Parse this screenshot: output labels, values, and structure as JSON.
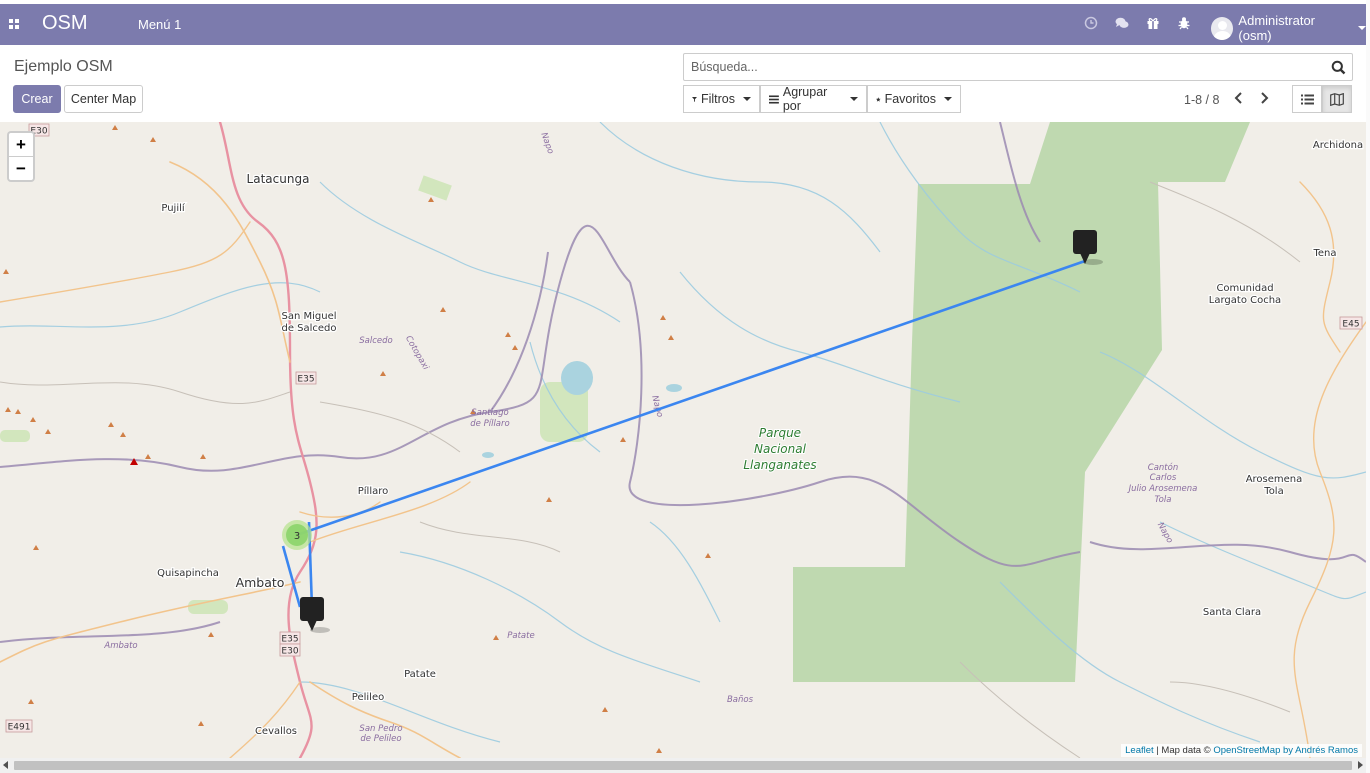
{
  "topbar": {
    "brand": "OSM",
    "menu_item": "Menú 1",
    "user_name": "Administrator (osm)",
    "icons": [
      "clock-icon",
      "chat-icon",
      "gift-icon",
      "bug-icon"
    ],
    "accent_color": "#7c7bad"
  },
  "control_panel": {
    "title": "Ejemplo OSM",
    "create_label": "Crear",
    "center_label": "Center Map",
    "search_placeholder": "Búsqueda...",
    "filters_label": "Filtros",
    "group_label": "Agrupar por",
    "favorites_label": "Favoritos",
    "pager": "1-8 / 8",
    "active_view": "map"
  },
  "map": {
    "zoom_in": "+",
    "zoom_out": "−",
    "attribution_leaflet": "Leaflet",
    "attribution_mid": " | Map data © ",
    "attribution_osm": "OpenStreetMap by Andrés Ramos",
    "cluster_count": "3",
    "cluster_color": "#8cd46a",
    "route_color": "#3b86f0",
    "park_color": "#add19e",
    "labels": {
      "latacunga": "Latacunga",
      "pujili": "Pujilí",
      "salcedo1": "San Miguel",
      "salcedo2": "de Salcedo",
      "salcedo_river": "Salcedo",
      "cotopaxi": "Cotopaxi",
      "santiago1": "Santiago",
      "santiago2": "de Píllaro",
      "pillaro": "Píllaro",
      "quisapincha": "Quisapincha",
      "ambato": "Ambato",
      "ambato_small": "Ambato",
      "patate_small": "Patate",
      "patate": "Patate",
      "pelileo": "Pelileo",
      "cevallos": "Cevallos",
      "sanpedro1": "San Pedro",
      "sanpedro2": "de Pelileo",
      "banos": "Baños",
      "parque1": "Parque",
      "parque2": "Nacional",
      "parque3": "Llanganates",
      "archidona": "Archidona",
      "tena": "Tena",
      "comunidad1": "Comunidad",
      "comunidad2": "Largato Cocha",
      "arosemena1": "Arosemena",
      "arosemena2": "Tola",
      "canton1": "Cantón",
      "canton2": "Carlos",
      "canton3": "Julio Arosemena",
      "canton4": "Tola",
      "santaclara": "Santa Clara",
      "napo1": "Napo",
      "napo2": "Napo",
      "napo3": "Napo"
    },
    "road_shields": {
      "e30_top": "E30",
      "e35": "E35",
      "e45": "E45",
      "e35b": "E35",
      "e30b": "E30",
      "e491": "E491"
    }
  }
}
